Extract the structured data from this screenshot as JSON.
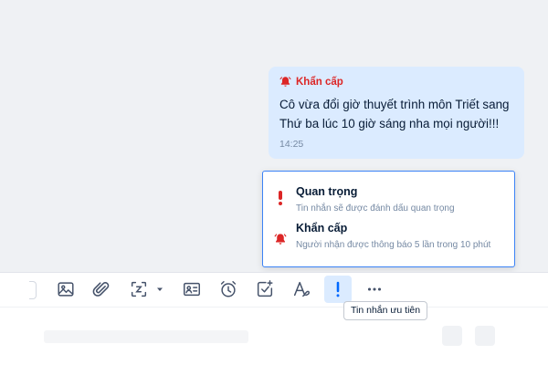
{
  "message": {
    "tag_label": "Khẩn cấp",
    "text_line1": "Cô vừa đổi giờ thuyết trình môn Triết sang",
    "text_line2": "Thứ ba lúc 10 giờ sáng nha mọi người!!!",
    "time": "14:25",
    "tag_icon": "bell-icon"
  },
  "priority_menu": {
    "items": [
      {
        "title": "Quan trọng",
        "description": "Tin nhắn sẽ được đánh dấu quan trọng",
        "icon": "exclamation-icon"
      },
      {
        "title": "Khẩn cấp",
        "description": "Người nhận được thông báo 5 lần trong 10 phút",
        "icon": "bell-icon"
      }
    ]
  },
  "toolbar": {
    "icons": [
      "image-icon",
      "paperclip-icon",
      "screenshot-icon",
      "contact-card-icon",
      "alarm-clock-icon",
      "task-icon",
      "text-format-icon",
      "priority-icon",
      "more-icon"
    ],
    "tooltip": "Tin nhắn ưu tiên"
  },
  "colors": {
    "accent": "#0068ff",
    "urgent": "#dc2626",
    "bubble": "#dbebff"
  }
}
